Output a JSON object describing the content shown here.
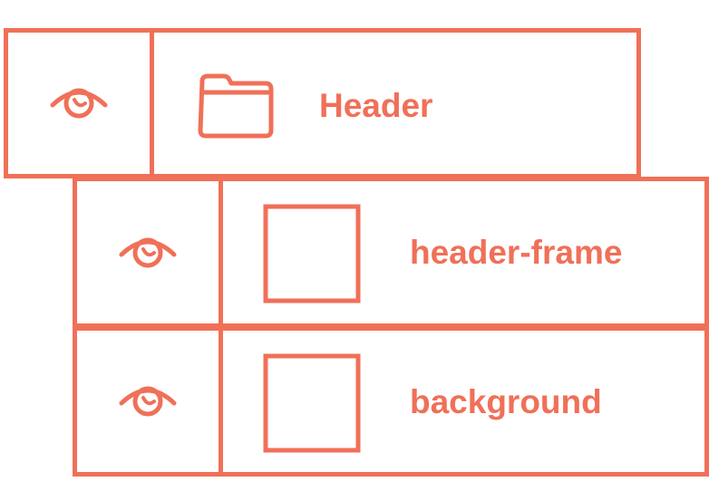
{
  "accent_color": "#f07058",
  "layers": [
    {
      "label": "Header",
      "type_icon": "folder-icon",
      "visibility_icon": "eye-icon"
    },
    {
      "label": "header-frame",
      "type_icon": "frame-square-icon",
      "visibility_icon": "eye-icon"
    },
    {
      "label": "background",
      "type_icon": "frame-square-icon",
      "visibility_icon": "eye-icon"
    }
  ]
}
